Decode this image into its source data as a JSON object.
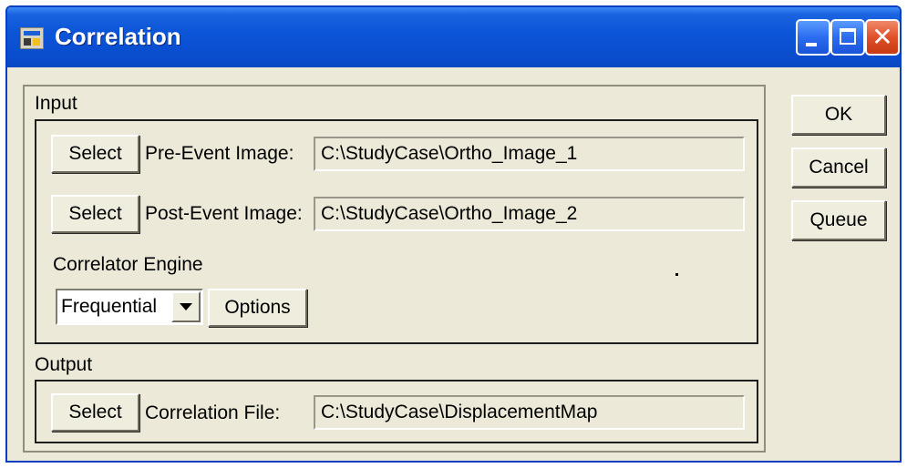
{
  "window": {
    "title": "Correlation",
    "icons": {
      "app": "app-icon",
      "minimize": "minimize-icon",
      "maximize": "maximize-icon",
      "close": "close-icon"
    },
    "close_glyph": "✕"
  },
  "colors": {
    "titlebar": "#0a4ed0",
    "close_button": "#e0502a",
    "dialog_background": "#ece9d8"
  },
  "input_group": {
    "label": "Input",
    "pre_event": {
      "button": "Select",
      "label": "Pre-Event Image:",
      "value": "C:\\StudyCase\\Ortho_Image_1"
    },
    "post_event": {
      "button": "Select",
      "label": "Post-Event Image:",
      "value": "C:\\StudyCase\\Ortho_Image_2"
    },
    "engine": {
      "label": "Correlator Engine",
      "selected": "Frequential",
      "options_button": "Options"
    }
  },
  "output_group": {
    "label": "Output",
    "correlation_file": {
      "button": "Select",
      "label": "Correlation File:",
      "value": "C:\\StudyCase\\DisplacementMap"
    }
  },
  "actions": {
    "ok": "OK",
    "cancel": "Cancel",
    "queue": "Queue"
  }
}
